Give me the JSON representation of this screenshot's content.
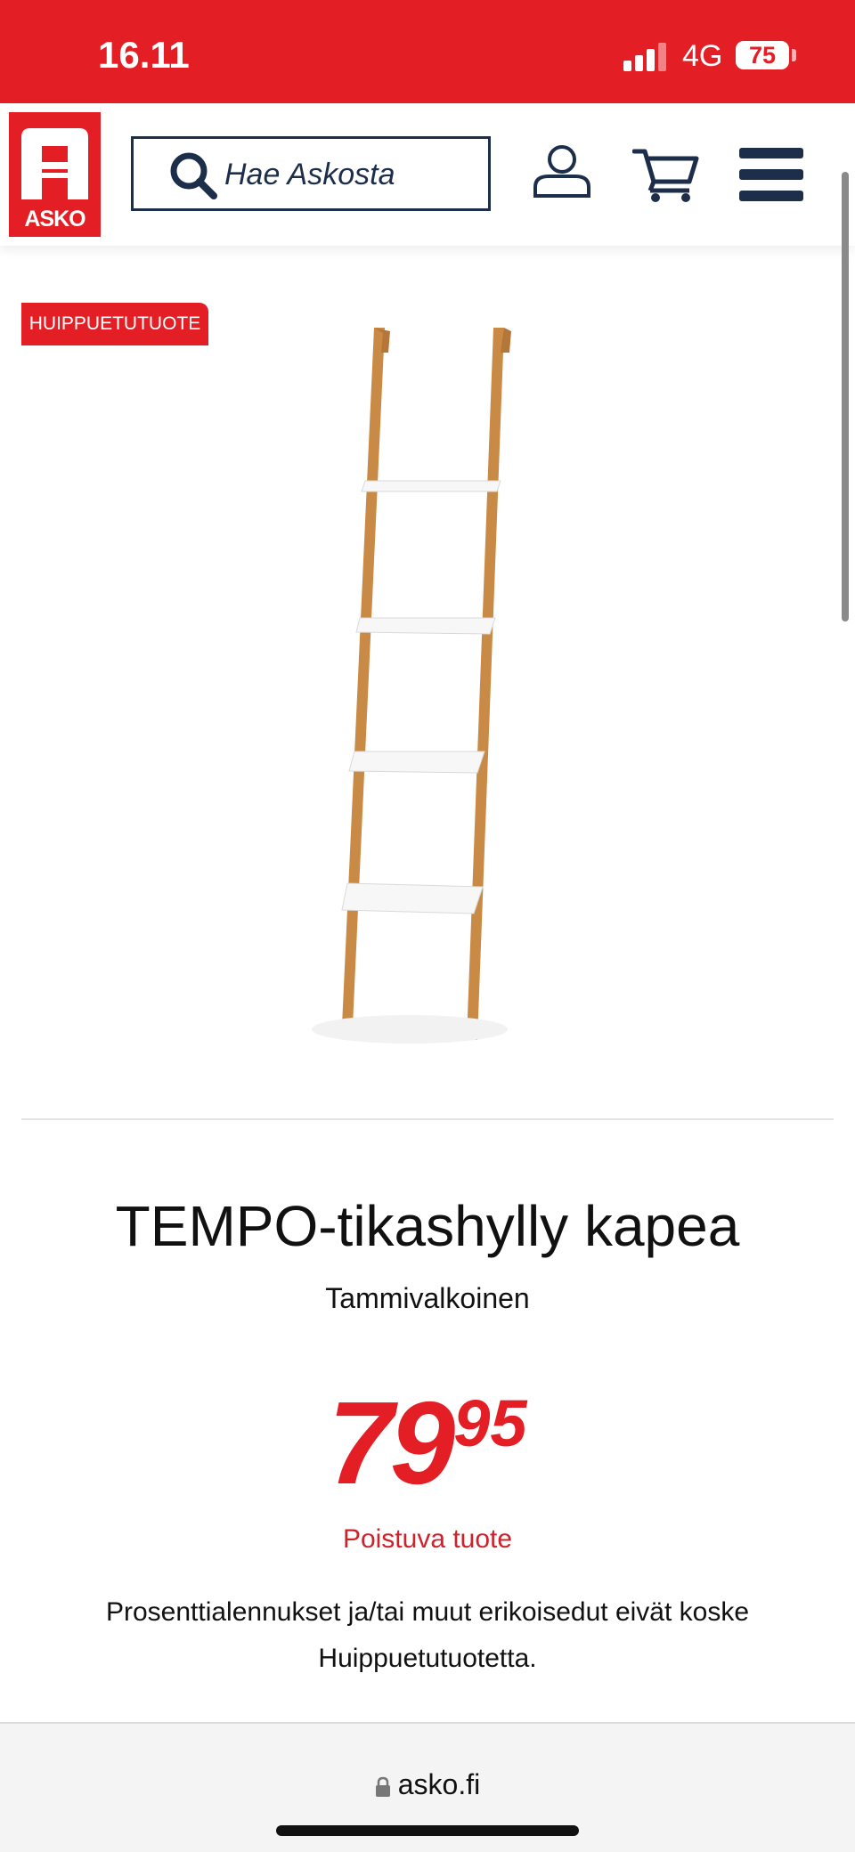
{
  "status_bar": {
    "time": "16.11",
    "network": "4G",
    "battery": "75",
    "accent_color": "#e31e24"
  },
  "header": {
    "logo_text": "ASKO",
    "search_placeholder": "Hae Askosta",
    "icons": [
      "search-icon",
      "account-icon",
      "cart-icon",
      "menu-icon"
    ]
  },
  "product": {
    "badge": "HUIPPUETUTUOTE",
    "title": "TEMPO-tikashylly kapea",
    "variant": "Tammivalkoinen",
    "price_main": "79",
    "price_cents": "95",
    "status": "Poistuva tuote",
    "disclaimer": "Prosenttialennukset ja/tai muut erikoisedut eivät koske Huippuetutuotetta."
  },
  "browser": {
    "url": "asko.fi"
  }
}
